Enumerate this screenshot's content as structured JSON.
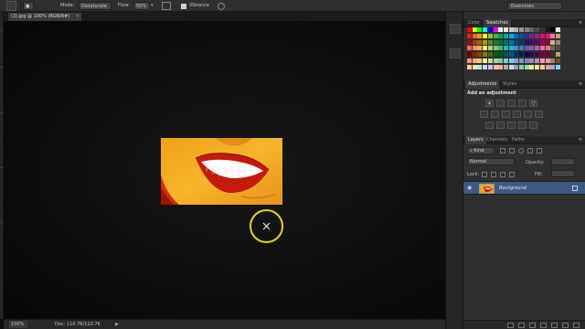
{
  "options_bar": {
    "mode_label": "Mode:",
    "mode_value": "Desaturate",
    "flow_label": "Flow:",
    "flow_value": "50%",
    "vibrance_label": "Vibrance",
    "workspace": "Essentials"
  },
  "document": {
    "tab_title": "(3).jpg @ 100% (RGB/8#)",
    "zoom": "100%",
    "doc_info": "Doc: 110.7K/110.7K"
  },
  "panels": {
    "color_tab": "Color",
    "swatches_tab": "Swatches",
    "adjustments_tab": "Adjustments",
    "styles_tab": "Styles",
    "adjustments_title": "Add an adjustment",
    "layers_tab": "Layers",
    "channels_tab": "Channels",
    "paths_tab": "Paths",
    "kind_label": "Kind",
    "blend_mode": "Normal",
    "opacity_label": "Opacity:",
    "lock_label": "Lock:",
    "fill_label": "Fill:",
    "layer_name": "Background"
  },
  "swatch_colors": [
    "#ff0000",
    "#ffff00",
    "#00ff00",
    "#00ffff",
    "#0000ff",
    "#ff00ff",
    "#ffffff",
    "#e6e6e6",
    "#cccccc",
    "#b3b3b3",
    "#999999",
    "#808080",
    "#666666",
    "#4d4d4d",
    "#333333",
    "#1a1a1a",
    "#000000",
    "#f0f0f0",
    "#ed1c24",
    "#f26522",
    "#f7941d",
    "#fff200",
    "#8dc63f",
    "#39b54a",
    "#00a651",
    "#00a99d",
    "#00aeef",
    "#0072bc",
    "#0054a6",
    "#2e3192",
    "#662d91",
    "#92278f",
    "#ec008c",
    "#ed145b",
    "#f06eaa",
    "#c69c6d",
    "#9e0b0f",
    "#a0410d",
    "#a36209",
    "#aba000",
    "#598527",
    "#1a7b30",
    "#007236",
    "#00746b",
    "#0076a3",
    "#004a80",
    "#003471",
    "#1b1464",
    "#440e62",
    "#630460",
    "#9e005d",
    "#9e0039",
    "#c7b299",
    "#998675",
    "#f26c4f",
    "#f68e56",
    "#fbaf5d",
    "#fff568",
    "#acd373",
    "#7cc576",
    "#3cb878",
    "#1cbbb4",
    "#00bff3",
    "#448ccb",
    "#5574b9",
    "#605ca8",
    "#8560a8",
    "#a864a8",
    "#f06eaa",
    "#f26d7d",
    "#736357",
    "#534741",
    "#790000",
    "#7b2e00",
    "#7d4900",
    "#827b00",
    "#406618",
    "#005e20",
    "#005826",
    "#005952",
    "#005b7f",
    "#003663",
    "#002157",
    "#0d004c",
    "#32004b",
    "#4b0049",
    "#7b0046",
    "#7a0026",
    "#362f2d",
    "#c69c6d",
    "#f7977a",
    "#f9ad81",
    "#fdc68a",
    "#fff799",
    "#c4df9b",
    "#a3d39c",
    "#82ca9d",
    "#7accc8",
    "#6dcff6",
    "#7da7d9",
    "#8393ca",
    "#8781bd",
    "#a186be",
    "#bd8cbf",
    "#f49ac2",
    "#f6989d",
    "#998675",
    "#754c24",
    "#ffcc99",
    "#ffe0b2",
    "#c8e6c9",
    "#b3e5fc",
    "#d1c4e9",
    "#f8bbd0",
    "#ffab91",
    "#bcaaa4",
    "#cfd8dc",
    "#90a4ae",
    "#80cbc4",
    "#a5d6a7",
    "#e6ee9c",
    "#ffe082",
    "#ffcc80",
    "#ef9a9a",
    "#b39ddb",
    "#81d4fa"
  ]
}
